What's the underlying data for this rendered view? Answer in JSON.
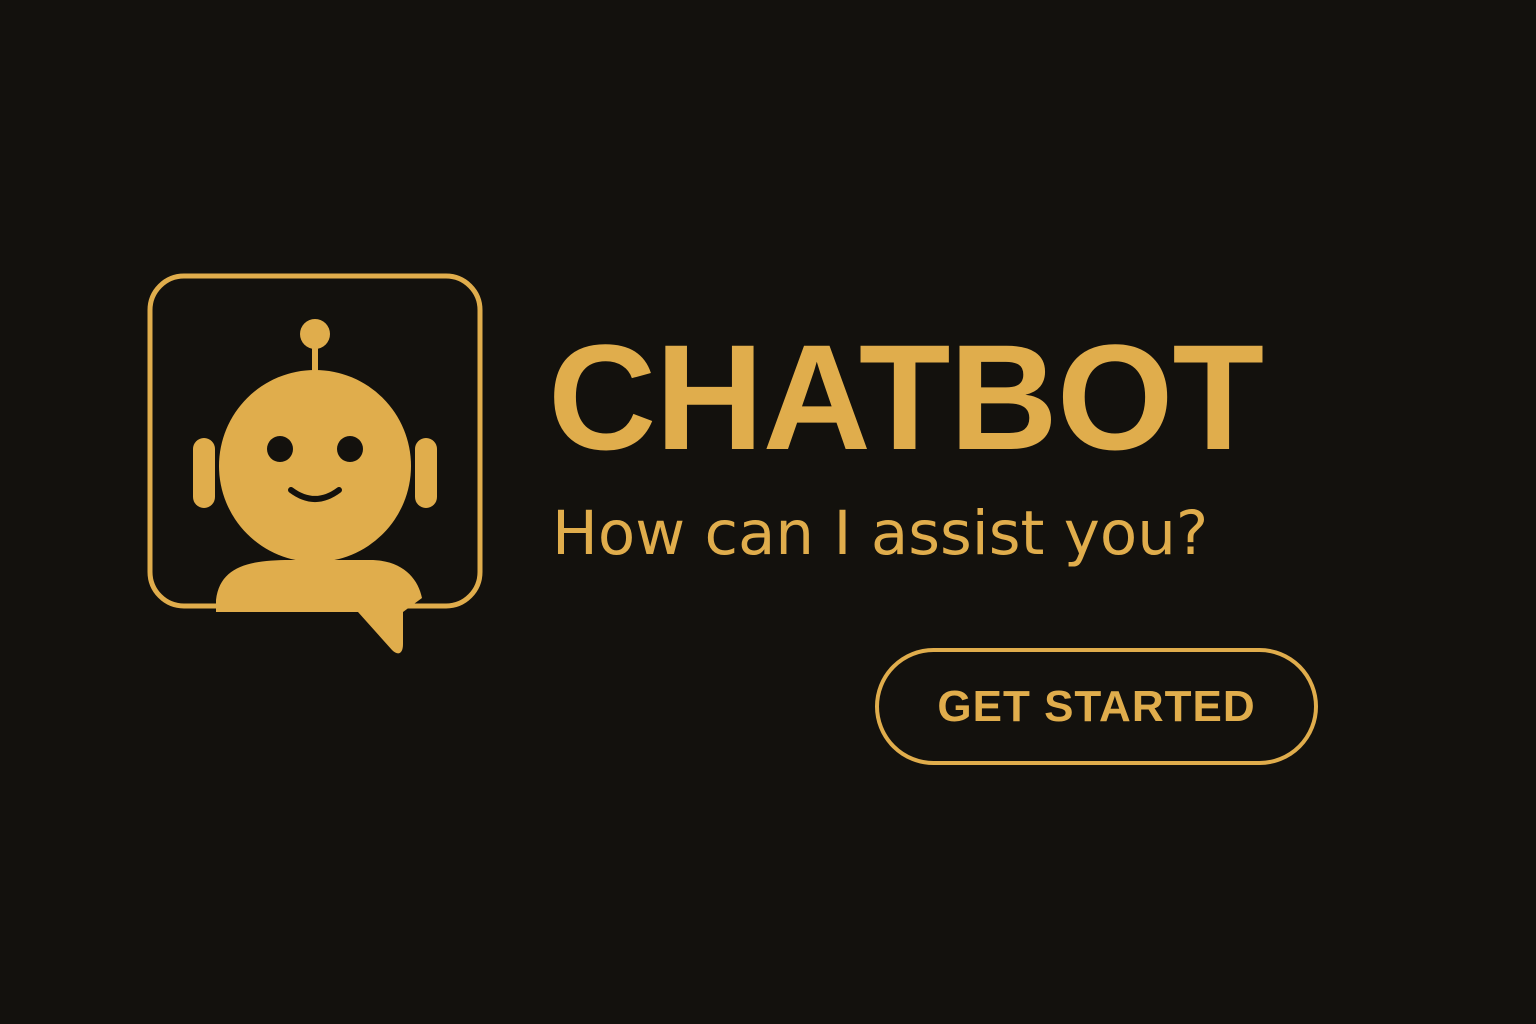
{
  "brand": {
    "title": "CHATBOT",
    "tagline": "How can I assist you?",
    "accent_color": "#e0ad4c",
    "background_color": "#13110d"
  },
  "logo": {
    "icon": "robot-chat-bubble-icon"
  },
  "cta": {
    "label": "GET STARTED"
  }
}
